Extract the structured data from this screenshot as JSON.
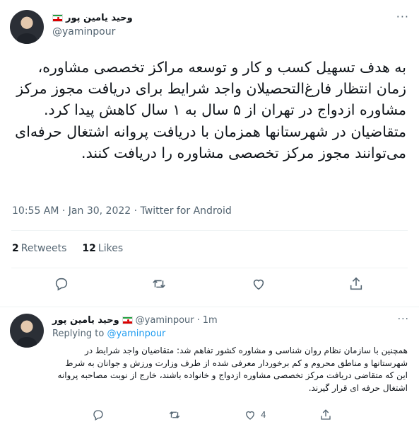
{
  "main_tweet": {
    "author_name": "وحید یامین پور",
    "handle": "@yaminpour",
    "more_label": "···",
    "text": "به هدف تسهیل کسب و کار و توسعه مراکز تخصصی مشاوره، زمان انتظار فارغ‌التحصیلان واجد شرایط برای دریافت مجوز مرکز مشاوره ازدواج در تهران از ۵ سال به ۱ سال کاهش پیدا کرد.\nمتقاضیان در شهرستانها همزمان با دریافت پروانه اشتغال حرفه‌ای می‌توانند مجوز مرکز تخصصی مشاوره را دریافت کنند.",
    "meta": "10:55 AM · Jan 30, 2022 · Twitter for Android",
    "retweets_count": "2",
    "retweets_label": "Retweets",
    "likes_count": "12",
    "likes_label": "Likes"
  },
  "reply_tweet": {
    "author_name": "وحید یامین پور",
    "handle": "@yaminpour",
    "separator": "·",
    "time": "1m",
    "more_label": "···",
    "replying_to_label": "Replying to",
    "replying_to_handle": "@yaminpour",
    "text": "همچنین با سازمان نظام روان شناسی و مشاوره کشور تفاهم شد: متقاضیان واجد شرایط در شهرستانها و مناطق محروم و کم برخوردار معرفی شده از طرف وزارت ورزش و جوانان به شرط این که متقاضی دریافت مرکز تخصصی مشاوره ازدواج و خانواده باشند، خارج از نوبت مصاحبه پروانه اشتغال حرفه ای قرار گیرند.",
    "likes_count": "4"
  },
  "colors": {
    "text": "#0f1419",
    "muted": "#536471",
    "link": "#1d9bf0",
    "divider": "#eff3f4"
  }
}
